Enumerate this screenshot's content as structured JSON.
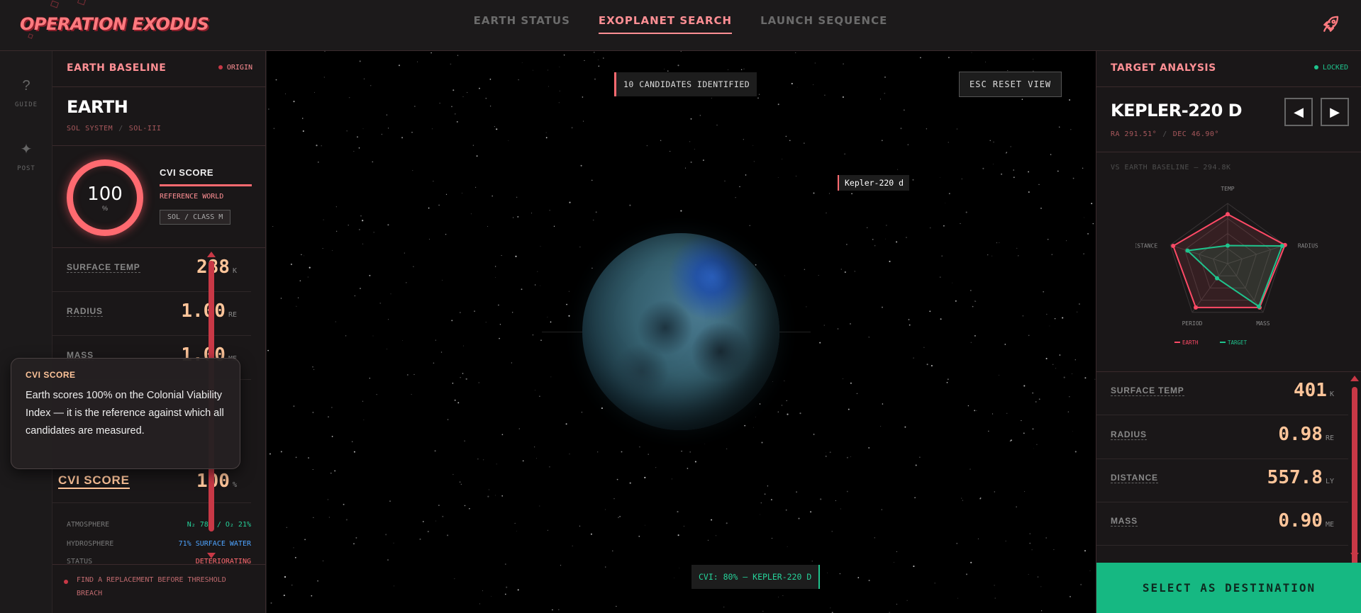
{
  "header": {
    "logo": "OPERATION EXODUS",
    "tabs": [
      {
        "label": "EARTH STATUS",
        "active": false
      },
      {
        "label": "EXOPLANET SEARCH",
        "active": true
      },
      {
        "label": "LAUNCH SEQUENCE",
        "active": false
      }
    ],
    "rocket_icon": "rocket-icon"
  },
  "rail": {
    "items": [
      {
        "icon": "question-icon",
        "glyph": "?",
        "label": "GUIDE"
      },
      {
        "icon": "sparkle-icon",
        "glyph": "✦",
        "label": "POST"
      }
    ]
  },
  "left_panel": {
    "title": "EARTH BASELINE",
    "tag": "ORIGIN",
    "planet_name": "EARTH",
    "system": "SOL SYSTEM",
    "designation": "SOL-III",
    "gauge_value": "100",
    "gauge_unit": "%",
    "cvi_title": "CVI SCORE",
    "cvi_ref": "REFERENCE WORLD",
    "cvi_class": "SOL / CLASS M",
    "stats": [
      {
        "label": "SURFACE TEMP",
        "value": "288",
        "unit": "K"
      },
      {
        "label": "RADIUS",
        "value": "1.00",
        "unit": "RE"
      },
      {
        "label": "MASS",
        "value": "1.00",
        "unit": "ME"
      }
    ],
    "cvi_row": {
      "label": "CVI SCORE",
      "value": "100",
      "unit": "%"
    },
    "info": [
      {
        "label": "ATMOSPHERE",
        "value": "N₂ 78% / O₂ 21%",
        "color": "#26d29a"
      },
      {
        "label": "HYDROSPHERE",
        "value": "71% SURFACE WATER",
        "color": "#4ea4ff"
      },
      {
        "label": "STATUS",
        "value": "DETERIORATING",
        "color": "#ff6a70"
      }
    ],
    "warning": "FIND A REPLACEMENT BEFORE THRESHOLD BREACH"
  },
  "tooltip": {
    "title": "CVI SCORE",
    "body": "Earth scores 100% on the Colonial Viability Index — it is the reference against which all candidates are measured."
  },
  "space": {
    "candidates": "10 CANDIDATES IDENTIFIED",
    "reset": "ESC  RESET VIEW",
    "planet_tag": "Kepler-220 d",
    "cvi_readout": "CVI: 80% — KEPLER-220 D"
  },
  "right_panel": {
    "title": "TARGET ANALYSIS",
    "tag": "LOCKED",
    "planet_name": "KEPLER-220 D",
    "ra": "RA 291.51°",
    "dec": "DEC 46.90°",
    "vs_label": "VS EARTH BASELINE — 294.8K",
    "radar": {
      "axes": [
        "TEMP",
        "RADIUS",
        "MASS",
        "PERIOD",
        "DISTANCE"
      ],
      "earth_label": "EARTH",
      "target_label": "TARGET",
      "earth_values": [
        0.82,
        1.0,
        0.9,
        0.9,
        0.95
      ],
      "target_values": [
        0.3,
        0.95,
        0.88,
        0.3,
        0.7
      ]
    },
    "stats": [
      {
        "label": "SURFACE TEMP",
        "value": "401",
        "unit": "K"
      },
      {
        "label": "RADIUS",
        "value": "0.98",
        "unit": "RE"
      },
      {
        "label": "DISTANCE",
        "value": "557.8",
        "unit": "LY"
      },
      {
        "label": "MASS",
        "value": "0.90",
        "unit": "ME"
      }
    ],
    "select": "SELECT AS DESTINATION"
  },
  "colors": {
    "accent": "#ff6a70",
    "green": "#1fc38d",
    "value": "#ffc59a"
  }
}
